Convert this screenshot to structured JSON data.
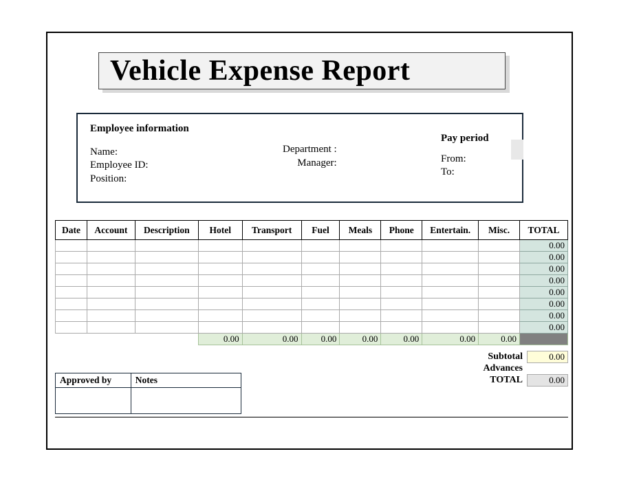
{
  "title": "Vehicle Expense Report",
  "employeeInfo": {
    "heading": "Employee information",
    "name_label": "Name:",
    "id_label": "Employee ID:",
    "position_label": "Position:",
    "department_label": "Department :",
    "manager_label": "Manager:"
  },
  "payPeriod": {
    "heading": "Pay period",
    "from_label": "From:",
    "to_label": "To:"
  },
  "columns": [
    "Date",
    "Account",
    "Description",
    "Hotel",
    "Transport",
    "Fuel",
    "Meals",
    "Phone",
    "Entertain.",
    "Misc.",
    "TOTAL"
  ],
  "rows": [
    {
      "total": "0.00"
    },
    {
      "total": "0.00"
    },
    {
      "total": "0.00"
    },
    {
      "total": "0.00"
    },
    {
      "total": "0.00"
    },
    {
      "total": "0.00"
    },
    {
      "total": "0.00"
    },
    {
      "total": "0.00"
    }
  ],
  "columnSums": [
    "0.00",
    "0.00",
    "0.00",
    "0.00",
    "0.00",
    "0.00",
    "0.00"
  ],
  "summary": {
    "subtotal_label": "Subtotal",
    "subtotal_value": "0.00",
    "advances_label": "Advances",
    "advances_value": "",
    "total_label": "TOTAL",
    "total_value": "0.00"
  },
  "approval": {
    "approved_by_label": "Approved by",
    "notes_label": "Notes"
  }
}
